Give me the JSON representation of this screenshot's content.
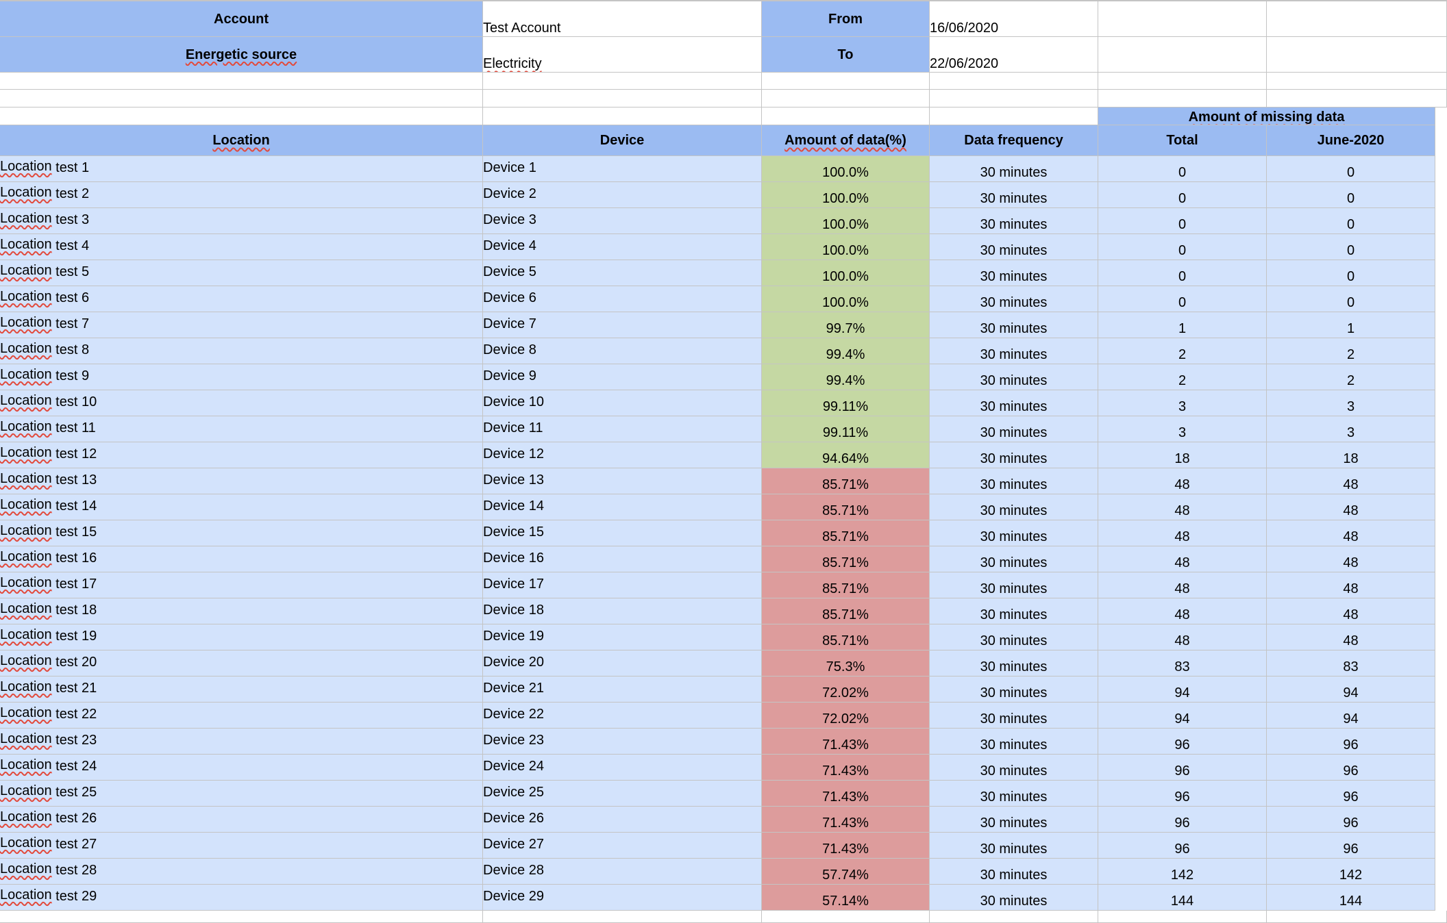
{
  "header": {
    "account_label": "Account",
    "account_value": "Test Account",
    "source_label": "Energetic source",
    "source_value": "Electricity",
    "from_label": "From",
    "from_value": "16/06/2020",
    "to_label": "To",
    "to_value": "22/06/2020"
  },
  "table": {
    "missing_group_label": "Amount of missing data",
    "columns": [
      "Location",
      "Device",
      "Amount of data(%)",
      "Data frequency",
      "Total",
      "June-2020"
    ],
    "good_color": "#c5d8a3",
    "bad_color": "#dd9c9c",
    "header_color": "#9bbbf2",
    "body_color": "#d3e3fc",
    "rows": [
      {
        "location": "Location test 1",
        "device": "Device 1",
        "amount": "100.0%",
        "frequency": "30 minutes",
        "total": "0",
        "june": "0",
        "status": "good"
      },
      {
        "location": "Location test 2",
        "device": "Device 2",
        "amount": "100.0%",
        "frequency": "30 minutes",
        "total": "0",
        "june": "0",
        "status": "good"
      },
      {
        "location": "Location test 3",
        "device": "Device 3",
        "amount": "100.0%",
        "frequency": "30 minutes",
        "total": "0",
        "june": "0",
        "status": "good"
      },
      {
        "location": "Location test 4",
        "device": "Device 4",
        "amount": "100.0%",
        "frequency": "30 minutes",
        "total": "0",
        "june": "0",
        "status": "good"
      },
      {
        "location": "Location test 5",
        "device": "Device 5",
        "amount": "100.0%",
        "frequency": "30 minutes",
        "total": "0",
        "june": "0",
        "status": "good"
      },
      {
        "location": "Location test 6",
        "device": "Device 6",
        "amount": "100.0%",
        "frequency": "30 minutes",
        "total": "0",
        "june": "0",
        "status": "good"
      },
      {
        "location": "Location test 7",
        "device": "Device 7",
        "amount": "99.7%",
        "frequency": "30 minutes",
        "total": "1",
        "june": "1",
        "status": "good"
      },
      {
        "location": "Location test 8",
        "device": "Device 8",
        "amount": "99.4%",
        "frequency": "30 minutes",
        "total": "2",
        "june": "2",
        "status": "good"
      },
      {
        "location": "Location test 9",
        "device": "Device 9",
        "amount": "99.4%",
        "frequency": "30 minutes",
        "total": "2",
        "june": "2",
        "status": "good"
      },
      {
        "location": "Location test 10",
        "device": "Device 10",
        "amount": "99.11%",
        "frequency": "30 minutes",
        "total": "3",
        "june": "3",
        "status": "good"
      },
      {
        "location": "Location test 11",
        "device": "Device 11",
        "amount": "99.11%",
        "frequency": "30 minutes",
        "total": "3",
        "june": "3",
        "status": "good"
      },
      {
        "location": "Location test 12",
        "device": "Device 12",
        "amount": "94.64%",
        "frequency": "30 minutes",
        "total": "18",
        "june": "18",
        "status": "good"
      },
      {
        "location": "Location test 13",
        "device": "Device 13",
        "amount": "85.71%",
        "frequency": "30 minutes",
        "total": "48",
        "june": "48",
        "status": "bad"
      },
      {
        "location": "Location test 14",
        "device": "Device 14",
        "amount": "85.71%",
        "frequency": "30 minutes",
        "total": "48",
        "june": "48",
        "status": "bad"
      },
      {
        "location": "Location test 15",
        "device": "Device 15",
        "amount": "85.71%",
        "frequency": "30 minutes",
        "total": "48",
        "june": "48",
        "status": "bad"
      },
      {
        "location": "Location test 16",
        "device": "Device 16",
        "amount": "85.71%",
        "frequency": "30 minutes",
        "total": "48",
        "june": "48",
        "status": "bad"
      },
      {
        "location": "Location test 17",
        "device": "Device 17",
        "amount": "85.71%",
        "frequency": "30 minutes",
        "total": "48",
        "june": "48",
        "status": "bad"
      },
      {
        "location": "Location test 18",
        "device": "Device 18",
        "amount": "85.71%",
        "frequency": "30 minutes",
        "total": "48",
        "june": "48",
        "status": "bad"
      },
      {
        "location": "Location test 19",
        "device": "Device 19",
        "amount": "85.71%",
        "frequency": "30 minutes",
        "total": "48",
        "june": "48",
        "status": "bad"
      },
      {
        "location": "Location test 20",
        "device": "Device 20",
        "amount": "75.3%",
        "frequency": "30 minutes",
        "total": "83",
        "june": "83",
        "status": "bad"
      },
      {
        "location": "Location test 21",
        "device": "Device 21",
        "amount": "72.02%",
        "frequency": "30 minutes",
        "total": "94",
        "june": "94",
        "status": "bad"
      },
      {
        "location": "Location test 22",
        "device": "Device 22",
        "amount": "72.02%",
        "frequency": "30 minutes",
        "total": "94",
        "june": "94",
        "status": "bad"
      },
      {
        "location": "Location test 23",
        "device": "Device 23",
        "amount": "71.43%",
        "frequency": "30 minutes",
        "total": "96",
        "june": "96",
        "status": "bad"
      },
      {
        "location": "Location test 24",
        "device": "Device 24",
        "amount": "71.43%",
        "frequency": "30 minutes",
        "total": "96",
        "june": "96",
        "status": "bad"
      },
      {
        "location": "Location test 25",
        "device": "Device 25",
        "amount": "71.43%",
        "frequency": "30 minutes",
        "total": "96",
        "june": "96",
        "status": "bad"
      },
      {
        "location": "Location test 26",
        "device": "Device 26",
        "amount": "71.43%",
        "frequency": "30 minutes",
        "total": "96",
        "june": "96",
        "status": "bad"
      },
      {
        "location": "Location test 27",
        "device": "Device 27",
        "amount": "71.43%",
        "frequency": "30 minutes",
        "total": "96",
        "june": "96",
        "status": "bad"
      },
      {
        "location": "Location test 28",
        "device": "Device 28",
        "amount": "57.74%",
        "frequency": "30 minutes",
        "total": "142",
        "june": "142",
        "status": "bad"
      },
      {
        "location": "Location test 29",
        "device": "Device 29",
        "amount": "57.14%",
        "frequency": "30 minutes",
        "total": "144",
        "june": "144",
        "status": "bad"
      }
    ]
  }
}
